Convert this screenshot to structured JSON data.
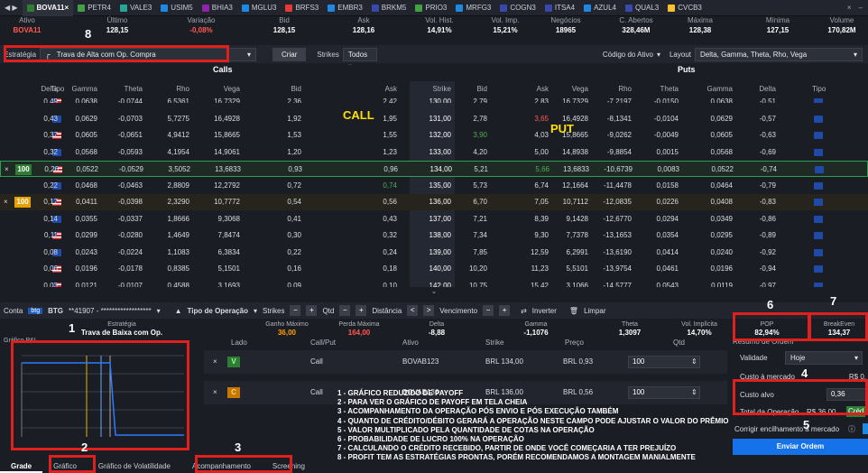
{
  "tabs": [
    {
      "label": "BOVA11",
      "color": "#2e7d32",
      "active": true
    },
    {
      "label": "PETR4",
      "color": "#43a047"
    },
    {
      "label": "VALE3",
      "color": "#26a69a"
    },
    {
      "label": "USIM5",
      "color": "#1e88e5"
    },
    {
      "label": "BHIA3",
      "color": "#8e24aa"
    },
    {
      "label": "MGLU3",
      "color": "#1e88e5"
    },
    {
      "label": "BRFS3",
      "color": "#e53935"
    },
    {
      "label": "EMBR3",
      "color": "#1e88e5"
    },
    {
      "label": "BRKM5",
      "color": "#3949ab"
    },
    {
      "label": "PRIO3",
      "color": "#43a047"
    },
    {
      "label": "MRFG3",
      "color": "#1e88e5"
    },
    {
      "label": "COGN3",
      "color": "#3949ab"
    },
    {
      "label": "ITSA4",
      "color": "#3949ab"
    },
    {
      "label": "AZUL4",
      "color": "#1e88e5"
    },
    {
      "label": "QUAL3",
      "color": "#3949ab"
    },
    {
      "label": "CVCB3",
      "color": "#fbc02d"
    }
  ],
  "quote": {
    "headers": [
      "Ativo",
      "Último",
      "Variação",
      "Bid",
      "Ask",
      "Vol. Hist.",
      "Vol. Imp.",
      "Negócios",
      "C. Abertos",
      "Máxima",
      "Mínima",
      "Volume"
    ],
    "values": [
      "BOVA11",
      "128,15",
      "-0,08%",
      "128,15",
      "128,16",
      "14,91%",
      "15,21%",
      "18965",
      "328,46M",
      "128,38",
      "127,15",
      "170,82M"
    ]
  },
  "strategy": {
    "label": "Estratégia",
    "value": "Trava de Alta com Op. Compra",
    "create_btn": "Criar",
    "strikes_label": "Strikes",
    "strikes_value": "Todos",
    "codigo_label": "Código do Ativo",
    "layout_label": "Layout",
    "layout_value": "Delta, Gamma, Theta, Rho, Vega"
  },
  "grid": {
    "calls_label": "Calls",
    "puts_label": "Puts",
    "call_annotation": "CALL",
    "put_annotation": "PUT",
    "call_headers": [
      "Tipo",
      "Delta",
      "Gamma",
      "Theta",
      "Rho",
      "Vega",
      "Bid",
      "Ask"
    ],
    "strike_header": "Strike",
    "put_headers": [
      "Bid",
      "Ask",
      "Vega",
      "Rho",
      "Theta",
      "Gamma",
      "Delta",
      "Tipo"
    ],
    "rows": [
      {
        "type": "us",
        "call": [
          "0,49",
          "0,0638",
          "-0,0744",
          "6,5361",
          "16,7329",
          "2,36",
          "2,42"
        ],
        "strike": "130,00",
        "put": [
          "2,79",
          "2,83",
          "16,7329",
          "-7,2197",
          "-0,0150",
          "0,0638",
          "-0,51"
        ],
        "putType": "eu"
      },
      {
        "type": "eu",
        "call": [
          "0,43",
          "0,0629",
          "-0,0703",
          "5,7275",
          "16,4928",
          "1,92",
          "1,95"
        ],
        "strike": "131,00",
        "put": [
          "2,78",
          "3,65",
          "16,4928",
          "-8,1341",
          "-0,0104",
          "0,0629",
          "-0,57"
        ],
        "putType": "eu",
        "putAskColor": "#ff5a4f"
      },
      {
        "type": "us",
        "call": [
          "0,37",
          "0,0605",
          "-0,0651",
          "4,9412",
          "15,8665",
          "1,53",
          "1,55"
        ],
        "strike": "132,00",
        "put": [
          "3,90",
          "4,03",
          "15,8665",
          "-9,0262",
          "-0,0049",
          "0,0605",
          "-0,63"
        ],
        "putType": "eu",
        "putBidColor": "#4caf50"
      },
      {
        "type": "eu",
        "call": [
          "0,32",
          "0,0568",
          "-0,0593",
          "4,1954",
          "14,9061",
          "1,20",
          "1,23"
        ],
        "strike": "133,00",
        "put": [
          "4,20",
          "5,00",
          "14,8938",
          "-9,8854",
          "0,0015",
          "0,0568",
          "-0,69"
        ],
        "putType": "eu"
      },
      {
        "type": "us",
        "call": [
          "0,26",
          "0,0522",
          "-0,0529",
          "3,5052",
          "13,6833",
          "0,93",
          "0,96"
        ],
        "strike": "134,00",
        "put": [
          "5,21",
          "5,66",
          "13,6833",
          "-10,6739",
          "0,0083",
          "0,0522",
          "-0,74"
        ],
        "putType": "eu",
        "putAskColor": "#4caf50",
        "selected": "green",
        "qty": "100"
      },
      {
        "type": "eu",
        "call": [
          "0,22",
          "0,0468",
          "-0,0463",
          "2,8809",
          "12,2792",
          "0,72",
          "0,74"
        ],
        "strike": "135,00",
        "put": [
          "5,73",
          "6,74",
          "12,1664",
          "-11,4478",
          "0,0158",
          "0,0464",
          "-0,79"
        ],
        "putType": "eu",
        "callAskColor": "#4caf50"
      },
      {
        "type": "us",
        "call": [
          "0,17",
          "0,0411",
          "-0,0398",
          "2,3290",
          "10,7772",
          "0,54",
          "0,56"
        ],
        "strike": "136,00",
        "put": [
          "6,70",
          "7,05",
          "10,7112",
          "-12,0835",
          "0,0226",
          "0,0408",
          "-0,83"
        ],
        "putType": "eu",
        "selected": "orange",
        "qty": "100"
      },
      {
        "type": "eu",
        "call": [
          "0,14",
          "0,0355",
          "-0,0337",
          "1,8666",
          "9,3068",
          "0,41",
          "0,43"
        ],
        "strike": "137,00",
        "put": [
          "7,21",
          "8,39",
          "9,1428",
          "-12,6770",
          "0,0294",
          "0,0349",
          "-0,86"
        ],
        "putType": "eu"
      },
      {
        "type": "us",
        "call": [
          "0,11",
          "0,0299",
          "-0,0280",
          "1,4649",
          "7,8474",
          "0,30",
          "0,32"
        ],
        "strike": "138,00",
        "put": [
          "7,34",
          "9,30",
          "7,7378",
          "-13,1653",
          "0,0354",
          "0,0295",
          "-0,89"
        ],
        "putType": "eu"
      },
      {
        "type": "eu",
        "call": [
          "0,08",
          "0,0243",
          "-0,0224",
          "1,1083",
          "6,3834",
          "0,22",
          "0,24"
        ],
        "strike": "139,00",
        "put": [
          "7,85",
          "12,59",
          "6,2991",
          "-13,6190",
          "0,0414",
          "0,0240",
          "-0,92"
        ],
        "putType": "eu"
      },
      {
        "type": "us",
        "call": [
          "0,06",
          "0,0196",
          "-0,0178",
          "0,8385",
          "5,1501",
          "0,16",
          "0,18"
        ],
        "strike": "140,00",
        "put": [
          "10,20",
          "11,23",
          "5,5101",
          "-13,9754",
          "0,0461",
          "0,0196",
          "-0,94"
        ],
        "putType": "eu"
      },
      {
        "type": "us",
        "call": [
          "0,03",
          "0,0121",
          "-0,0107",
          "0,4588",
          "3,1693",
          "0,09",
          "0,10"
        ],
        "strike": "142,00",
        "put": [
          "10,75",
          "15,42",
          "3,1066",
          "-14,5777",
          "0,0543",
          "0,0119",
          "-0,97"
        ],
        "putType": "eu"
      }
    ]
  },
  "orderbar": {
    "conta_label": "Conta",
    "broker": "BTG",
    "account": "**41907 - ******************",
    "tipo_label": "Tipo de Operação",
    "strikes_label": "Strikes",
    "qtd_label": "Qtd",
    "distancia_label": "Distância",
    "vencimento_label": "Vencimento",
    "inverter_label": "Inverter",
    "limpar_label": "Limpar"
  },
  "stats": {
    "estrategia_h": "Estratégia",
    "estrategia_v": "Trava de Baixa com Op. Compra",
    "ganho_h": "Ganho Máximo",
    "ganho_v": "36,00",
    "perda_h": "Perda Máxima",
    "perda_v": "164,00",
    "delta_h": "Delta",
    "delta_v": "-8,88",
    "gamma_h": "Gamma",
    "gamma_v": "-1,1076",
    "theta_h": "Theta",
    "theta_v": "1,3097",
    "vol_h": "Vol. Implícita",
    "vol_v": "14,70%",
    "pop_h": "POP",
    "pop_v": "82,94%",
    "be_h": "BreakEven",
    "be_v": "134,37"
  },
  "chart": {
    "label": "Gráfico P&L"
  },
  "legs": {
    "headers": [
      "Lado",
      "Call/Put",
      "Ativo",
      "Strike",
      "Preço",
      "Qtd"
    ],
    "rows": [
      {
        "side": "V",
        "sideColor": "#2e7d32",
        "cp": "Call",
        "ativo": "BOVAB123",
        "strike": "BRL 134,00",
        "preco": "BRL 0,93",
        "qtd": "100"
      },
      {
        "side": "C",
        "sideColor": "#c77800",
        "cp": "Call",
        "ativo": "BOVAB136",
        "strike": "BRL 136,00",
        "preco": "BRL 0,56",
        "qtd": "100"
      }
    ]
  },
  "resumo": {
    "title": "Resumo de Ordem",
    "validade_label": "Validade",
    "validade_value": "Hoje",
    "custo_mercado_label": "Custo à mercado",
    "custo_mercado_value": "R$ 0,",
    "custo_alvo_label": "Custo alvo",
    "custo_alvo_value": "0,36",
    "total_label": "Total da Operação",
    "total_value": "R$ 36,00",
    "total_badge": "Créd",
    "corrigir_label": "Corrigir encilhamento à mercado",
    "enviar_label": "Enviar Ordem"
  },
  "notes": [
    "1 - GRÁFICO REDUZIDO DE PAYOFF",
    "2 - PARA VER O GRÁFICO DE PAYOFF EM TELA CHEIA",
    "3 - ACOMPANHAMENTO DA OPERAÇÃO PÓS ENVIO E PÓS EXECUÇÃO TAMBÉM",
    "4 - QUANTO DE CRÉDITO/DÉBITO GERARÁ A OPERAÇÃO NESTE CAMPO PODE AJUSTAR O VALOR DO PRÊMIO",
    "5 - VALOR MULTIPLICADO PELA QUANTIDADE DE COTAS NA OPERAÇÃO",
    "6 -  PROBABILIDADE DE LUCRO 100% NA OPERAÇÃO",
    "7 - CALCULANDO O CRÉDITO RECEBIDO, PARTIR DE ONDE VOCÊ COMEÇARIA A TER PREJUÍZO",
    "8 - PROFIT TEM AS ESTRATÉGIAS PRONTAS, PORÉM RECOMENDAMOS A MONTAGEM MANIALMENTE"
  ],
  "markers": [
    "1",
    "2",
    "3",
    "4",
    "5",
    "6",
    "7",
    "8"
  ],
  "bottomtabs": [
    "Grade",
    "Gráfico",
    "Gráfico de Volatilidade",
    "Acompanhamento",
    "Screening"
  ]
}
